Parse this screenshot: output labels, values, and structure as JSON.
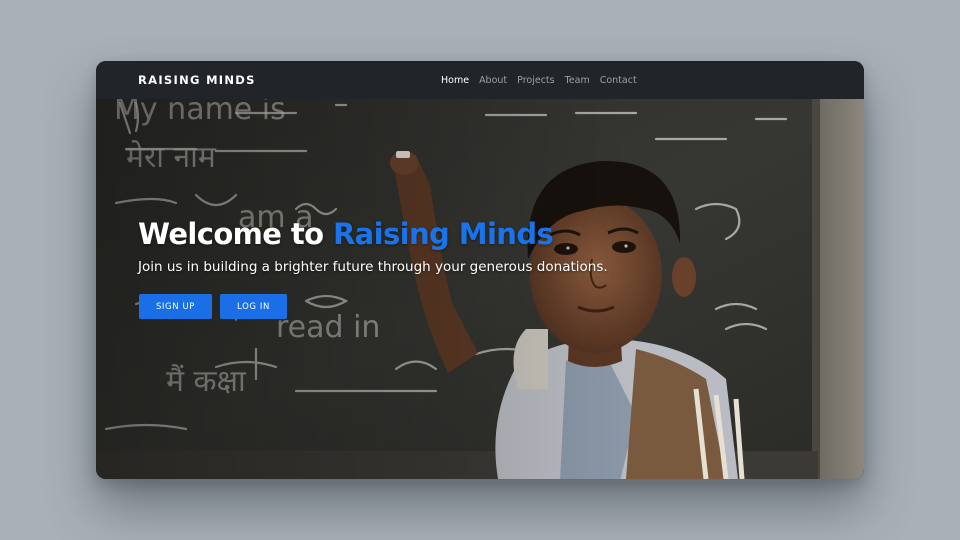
{
  "navbar": {
    "brand": "RAISING MINDS",
    "links": [
      {
        "label": "Home",
        "active": true
      },
      {
        "label": "About",
        "active": false
      },
      {
        "label": "Projects",
        "active": false
      },
      {
        "label": "Team",
        "active": false
      },
      {
        "label": "Contact",
        "active": false
      }
    ]
  },
  "hero": {
    "title_prefix": "Welcome to ",
    "title_accent": "Raising Minds",
    "subtitle": "Join us in building a brighter future through your generous donations.",
    "signup_label": "SIGN UP",
    "login_label": "LOG IN",
    "background_image": "child writing on chalkboard",
    "chalk_words": [
      "My name is",
      "मेरा नाम",
      "I am a",
      "read in",
      "मैं कक्षा"
    ]
  },
  "colors": {
    "accent": "#1a73e8",
    "button": "#1a6fe6",
    "navbar": "#212529",
    "page_background": "#a9b0b8"
  }
}
